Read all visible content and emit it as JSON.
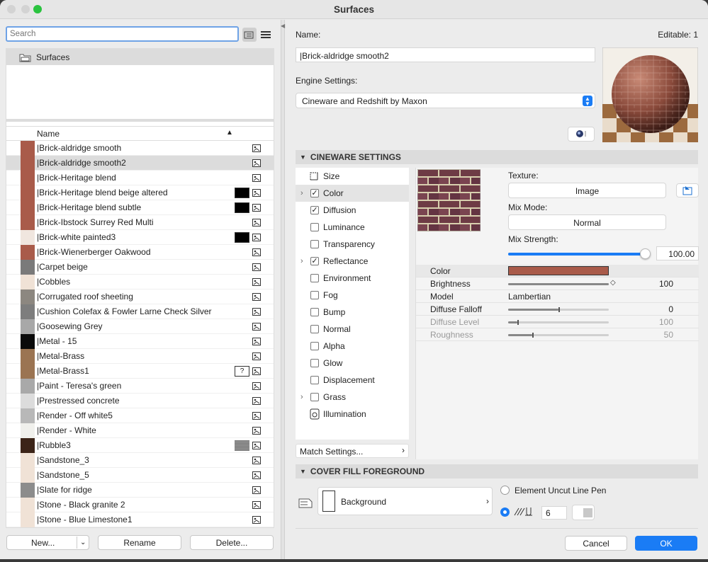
{
  "window": {
    "title": "Surfaces"
  },
  "left": {
    "search_placeholder": "Search",
    "tree_item": "Surfaces",
    "column_name": "Name",
    "materials": [
      {
        "name": "|Brick-aldridge smooth",
        "color": "#a95b4a",
        "pattern": "",
        "selected": false
      },
      {
        "name": "|Brick-aldridge smooth2",
        "color": "#a95b4a",
        "pattern": "",
        "selected": true
      },
      {
        "name": "|Brick-Heritage blend",
        "color": "#a95b4a",
        "pattern": "",
        "selected": false
      },
      {
        "name": "|Brick-Heritage blend beige altered",
        "color": "#a95b4a",
        "pattern": "dots",
        "selected": false
      },
      {
        "name": "|Brick-Heritage blend subtle",
        "color": "#a95b4a",
        "pattern": "dots",
        "selected": false
      },
      {
        "name": "|Brick-Ibstock Surrey Red Multi",
        "color": "#a95b4a",
        "pattern": "",
        "selected": false
      },
      {
        "name": "|Brick-white painted3",
        "color": "#f0e6df",
        "pattern": "dots",
        "selected": false
      },
      {
        "name": "|Brick-Wienerberger Oakwood",
        "color": "#a95b4a",
        "pattern": "",
        "selected": false
      },
      {
        "name": "|Carpet beige",
        "color": "#7a7a7a",
        "pattern": "",
        "selected": false
      },
      {
        "name": "|Cobbles",
        "color": "#f0e2d6",
        "pattern": "",
        "selected": false
      },
      {
        "name": "|Corrugated roof sheeting",
        "color": "#8c8780",
        "pattern": "",
        "selected": false
      },
      {
        "name": "|Cushion Colefax & Fowler Larne Check Silver",
        "color": "#7d7d7d",
        "pattern": "",
        "selected": false
      },
      {
        "name": "|Goosewing Grey",
        "color": "#a8a8a8",
        "pattern": "",
        "selected": false
      },
      {
        "name": "|Metal - 15",
        "color": "#0a0a0a",
        "pattern": "",
        "selected": false
      },
      {
        "name": "|Metal-Brass",
        "color": "#9b7452",
        "pattern": "",
        "selected": false
      },
      {
        "name": "|Metal-Brass1",
        "color": "#9b7452",
        "pattern": "?",
        "selected": false
      },
      {
        "name": "|Paint - Teresa's green",
        "color": "#a9a9a9",
        "pattern": "",
        "selected": false
      },
      {
        "name": "|Prestressed concrete",
        "color": "#dcdcdc",
        "pattern": "",
        "selected": false
      },
      {
        "name": "|Render - Off white5",
        "color": "#b8b8b8",
        "pattern": "",
        "selected": false
      },
      {
        "name": "|Render - White",
        "color": "#f0f0ec",
        "pattern": "",
        "selected": false
      },
      {
        "name": "|Rubble3",
        "color": "#3c2418",
        "pattern": "grey",
        "selected": false
      },
      {
        "name": "|Sandstone_3",
        "color": "#f0e2d6",
        "pattern": "",
        "selected": false
      },
      {
        "name": "|Sandstone_5",
        "color": "#f0e2d6",
        "pattern": "",
        "selected": false
      },
      {
        "name": "|Slate for ridge",
        "color": "#8c8c8c",
        "pattern": "",
        "selected": false
      },
      {
        "name": "|Stone - Black granite 2",
        "color": "#f0e2d6",
        "pattern": "",
        "selected": false
      },
      {
        "name": "|Stone - Blue Limestone1",
        "color": "#f0e2d6",
        "pattern": "",
        "selected": false
      }
    ],
    "buttons": {
      "new": "New...",
      "rename": "Rename",
      "delete": "Delete..."
    }
  },
  "right": {
    "name_label": "Name:",
    "editable": "Editable: 1",
    "name_value": "|Brick-aldridge smooth2",
    "engine_label": "Engine Settings:",
    "engine_value": "Cineware and Redshift by Maxon",
    "cineware_header": "CINEWARE SETTINGS",
    "channels": [
      {
        "name": "Size",
        "state": "icon",
        "arrow": false,
        "selected": false
      },
      {
        "name": "Color",
        "state": "checked",
        "arrow": true,
        "selected": true
      },
      {
        "name": "Diffusion",
        "state": "checked",
        "arrow": false,
        "selected": false
      },
      {
        "name": "Luminance",
        "state": "unchecked",
        "arrow": false,
        "selected": false
      },
      {
        "name": "Transparency",
        "state": "unchecked",
        "arrow": false,
        "selected": false
      },
      {
        "name": "Reflectance",
        "state": "checked",
        "arrow": true,
        "selected": false
      },
      {
        "name": "Environment",
        "state": "unchecked",
        "arrow": false,
        "selected": false
      },
      {
        "name": "Fog",
        "state": "unchecked",
        "arrow": false,
        "selected": false
      },
      {
        "name": "Bump",
        "state": "unchecked",
        "arrow": false,
        "selected": false
      },
      {
        "name": "Normal",
        "state": "unchecked",
        "arrow": false,
        "selected": false
      },
      {
        "name": "Alpha",
        "state": "unchecked",
        "arrow": false,
        "selected": false
      },
      {
        "name": "Glow",
        "state": "unchecked",
        "arrow": false,
        "selected": false
      },
      {
        "name": "Displacement",
        "state": "unchecked",
        "arrow": false,
        "selected": false
      },
      {
        "name": "Grass",
        "state": "unchecked",
        "arrow": true,
        "selected": false
      },
      {
        "name": "Illumination",
        "state": "icon",
        "arrow": false,
        "selected": false
      }
    ],
    "match_settings": "Match Settings...",
    "texture_label": "Texture:",
    "texture_value": "Image",
    "mix_mode_label": "Mix Mode:",
    "mix_mode_value": "Normal",
    "mix_strength_label": "Mix Strength:",
    "mix_strength_value": "100.00",
    "mix_strength_fraction": 1.0,
    "props": [
      {
        "label": "Color",
        "value": "",
        "kind": "color",
        "fraction": 0,
        "muted": false
      },
      {
        "label": "Brightness",
        "value": "100",
        "kind": "slider",
        "fraction": 1.0,
        "muted": false
      },
      {
        "label": "Model",
        "value": "Lambertian",
        "kind": "text",
        "fraction": 0,
        "muted": false
      },
      {
        "label": "Diffuse Falloff",
        "value": "0",
        "kind": "slider",
        "fraction": 0.5,
        "muted": false
      },
      {
        "label": "Diffuse Level",
        "value": "100",
        "kind": "slider",
        "fraction": 0.09,
        "muted": true
      },
      {
        "label": "Roughness",
        "value": "50",
        "kind": "slider",
        "fraction": 0.24,
        "muted": true
      }
    ],
    "color_swatch": "#a95b4a",
    "cover_header": "COVER FILL FOREGROUND",
    "background_label": "Background",
    "uncut_label": "Element Uncut Line Pen",
    "pen_value": "6",
    "cancel": "Cancel",
    "ok": "OK"
  },
  "colors": {
    "accent": "#1a7cf5",
    "brick": "#a95b4a"
  }
}
